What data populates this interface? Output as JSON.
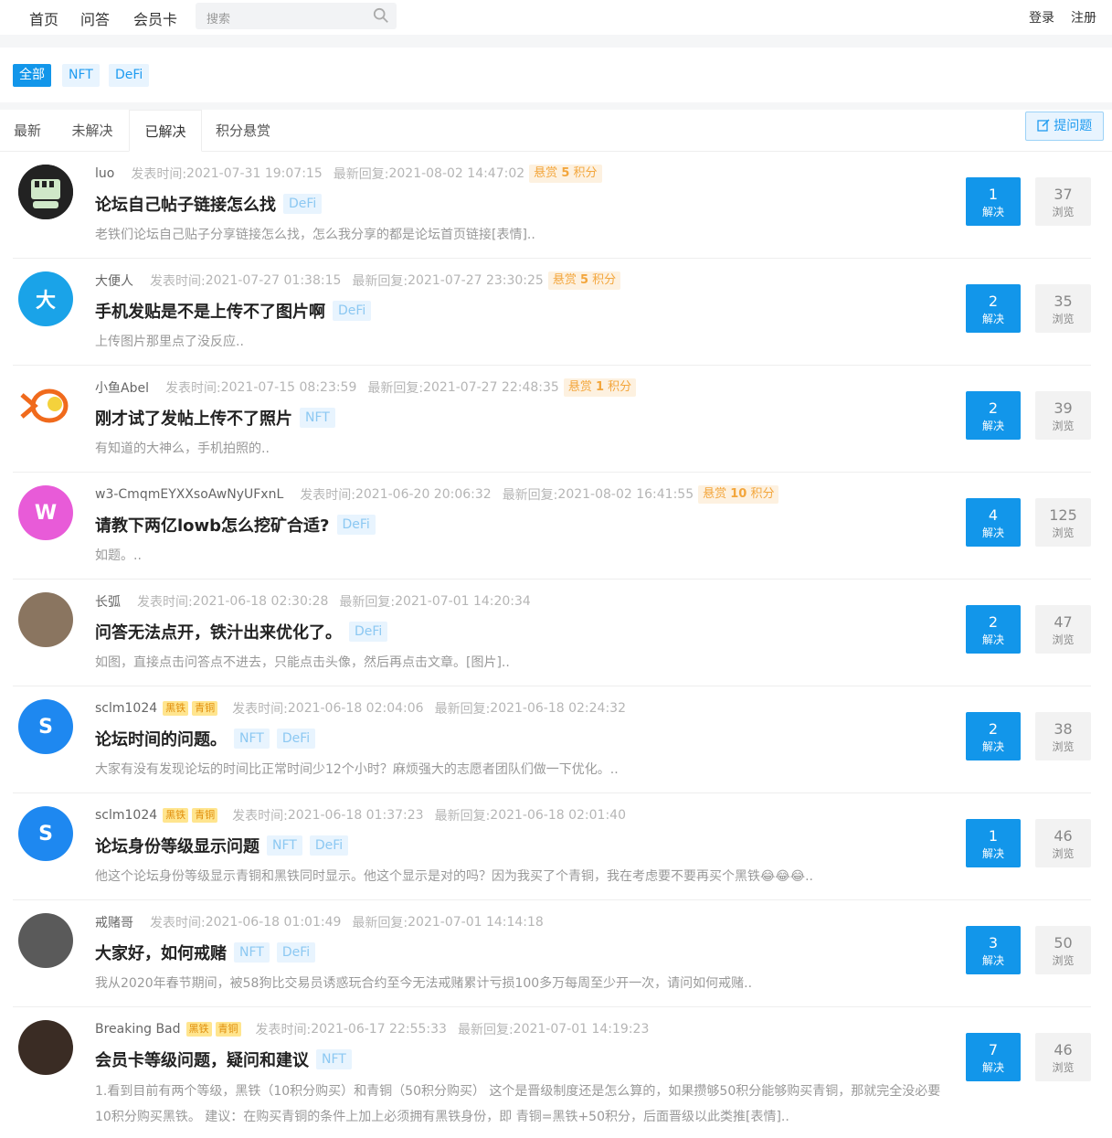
{
  "nav": {
    "links": [
      "首页",
      "问答",
      "会员卡"
    ],
    "search_placeholder": "搜索",
    "login": "登录",
    "register": "注册"
  },
  "tags": [
    "全部",
    "NFT",
    "DeFi"
  ],
  "tabs": [
    "最新",
    "未解决",
    "已解决",
    "积分悬赏"
  ],
  "ask_button": "提问题",
  "labels": {
    "posted": "发表时间:",
    "replied": "最新回复:",
    "bounty_prefix": "悬赏",
    "bounty_suffix": "积分",
    "solved": "解决",
    "views": "浏览"
  },
  "questions": [
    {
      "author": "luo",
      "badges": [],
      "posted": "2021-07-31 19:07:15",
      "replied": "2021-08-02 14:47:02",
      "bounty": "5",
      "title": "论坛自己帖子链接怎么找",
      "tags": [
        "DeFi"
      ],
      "excerpt": "老铁们论坛自己贴子分享链接怎么找，怎么我分享的都是论坛首页链接[表情]..",
      "solved": "1",
      "views": "37",
      "avatar": {
        "type": "fist",
        "bg": "#222222"
      }
    },
    {
      "author": "大便人",
      "badges": [],
      "posted": "2021-07-27 01:38:15",
      "replied": "2021-07-27 23:30:25",
      "bounty": "5",
      "title": "手机发贴是不是上传不了图片啊",
      "tags": [
        "DeFi"
      ],
      "excerpt": "上传图片那里点了没反应..",
      "solved": "2",
      "views": "35",
      "avatar": {
        "type": "letter",
        "letter": "大",
        "bg": "#1aa3e8"
      }
    },
    {
      "author": "小鱼Abel",
      "badges": [],
      "posted": "2021-07-15 08:23:59",
      "replied": "2021-07-27 22:48:35",
      "bounty": "1",
      "title": "刚才试了发帖上传不了照片",
      "tags": [
        "NFT"
      ],
      "excerpt": "有知道的大神么，手机拍照的..",
      "solved": "2",
      "views": "39",
      "avatar": {
        "type": "fish",
        "bg": "#ffffff"
      }
    },
    {
      "author": "w3-CmqmEYXXsoAwNyUFxnL",
      "badges": [],
      "posted": "2021-06-20 20:06:32",
      "replied": "2021-08-02 16:41:55",
      "bounty": "10",
      "title": "请教下两亿lowb怎么挖矿合适?",
      "tags": [
        "DeFi"
      ],
      "excerpt": "如题。..",
      "solved": "4",
      "views": "125",
      "avatar": {
        "type": "letter",
        "letter": "W",
        "bg": "#e85bd8"
      }
    },
    {
      "author": "长弧",
      "badges": [],
      "posted": "2021-06-18 02:30:28",
      "replied": "2021-07-01 14:20:34",
      "bounty": "",
      "title": "问答无法点开，铁汁出来优化了。",
      "tags": [
        "DeFi"
      ],
      "excerpt": "如图，直接点击问答点不进去，只能点击头像，然后再点击文章。[图片]..",
      "solved": "2",
      "views": "47",
      "avatar": {
        "type": "photo",
        "bg": "#8a7560"
      }
    },
    {
      "author": "sclm1024",
      "badges": [
        "黑铁",
        "青铜"
      ],
      "posted": "2021-06-18 02:04:06",
      "replied": "2021-06-18 02:24:32",
      "bounty": "",
      "title": "论坛时间的问题。",
      "tags": [
        "NFT",
        "DeFi"
      ],
      "excerpt": "大家有没有发现论坛的时间比正常时间少12个小时？麻烦强大的志愿者团队们做一下优化。..",
      "solved": "2",
      "views": "38",
      "avatar": {
        "type": "letter",
        "letter": "S",
        "bg": "#1e88f0"
      }
    },
    {
      "author": "sclm1024",
      "badges": [
        "黑铁",
        "青铜"
      ],
      "posted": "2021-06-18 01:37:23",
      "replied": "2021-06-18 02:01:40",
      "bounty": "",
      "title": "论坛身份等级显示问题",
      "tags": [
        "NFT",
        "DeFi"
      ],
      "excerpt": "他这个论坛身份等级显示青铜和黑铁同时显示。他这个显示是对的吗？因为我买了个青铜，我在考虑要不要再买个黑铁😂😂😂..",
      "solved": "1",
      "views": "46",
      "avatar": {
        "type": "letter",
        "letter": "S",
        "bg": "#1e88f0"
      }
    },
    {
      "author": "戒赌哥",
      "badges": [],
      "posted": "2021-06-18 01:01:49",
      "replied": "2021-07-01 14:14:18",
      "bounty": "",
      "title": "大家好，如何戒赌",
      "tags": [
        "NFT",
        "DeFi"
      ],
      "excerpt": "我从2020年春节期间，被58狗比交易员诱惑玩合约至今无法戒赌累计亏损100多万每周至少开一次，请问如何戒赌..",
      "solved": "3",
      "views": "50",
      "avatar": {
        "type": "photo",
        "bg": "#5a5a5a"
      }
    },
    {
      "author": "Breaking Bad",
      "badges": [
        "黑铁",
        "青铜"
      ],
      "posted": "2021-06-17 22:55:33",
      "replied": "2021-07-01 14:19:23",
      "bounty": "",
      "title": "会员卡等级问题，疑问和建议",
      "tags": [
        "NFT"
      ],
      "excerpt": "1.看到目前有两个等级，黑铁（10积分购买）和青铜（50积分购买） 这个是晋级制度还是怎么算的，如果攒够50积分能够购买青铜，那就完全没必要10积分购买黑铁。 建议：在购买青铜的条件上加上必须拥有黑铁身份，即 青铜=黑铁+50积分，后面晋级以此类推[表情]..",
      "solved": "7",
      "views": "46",
      "avatar": {
        "type": "photo",
        "bg": "#3a2c24"
      }
    }
  ]
}
